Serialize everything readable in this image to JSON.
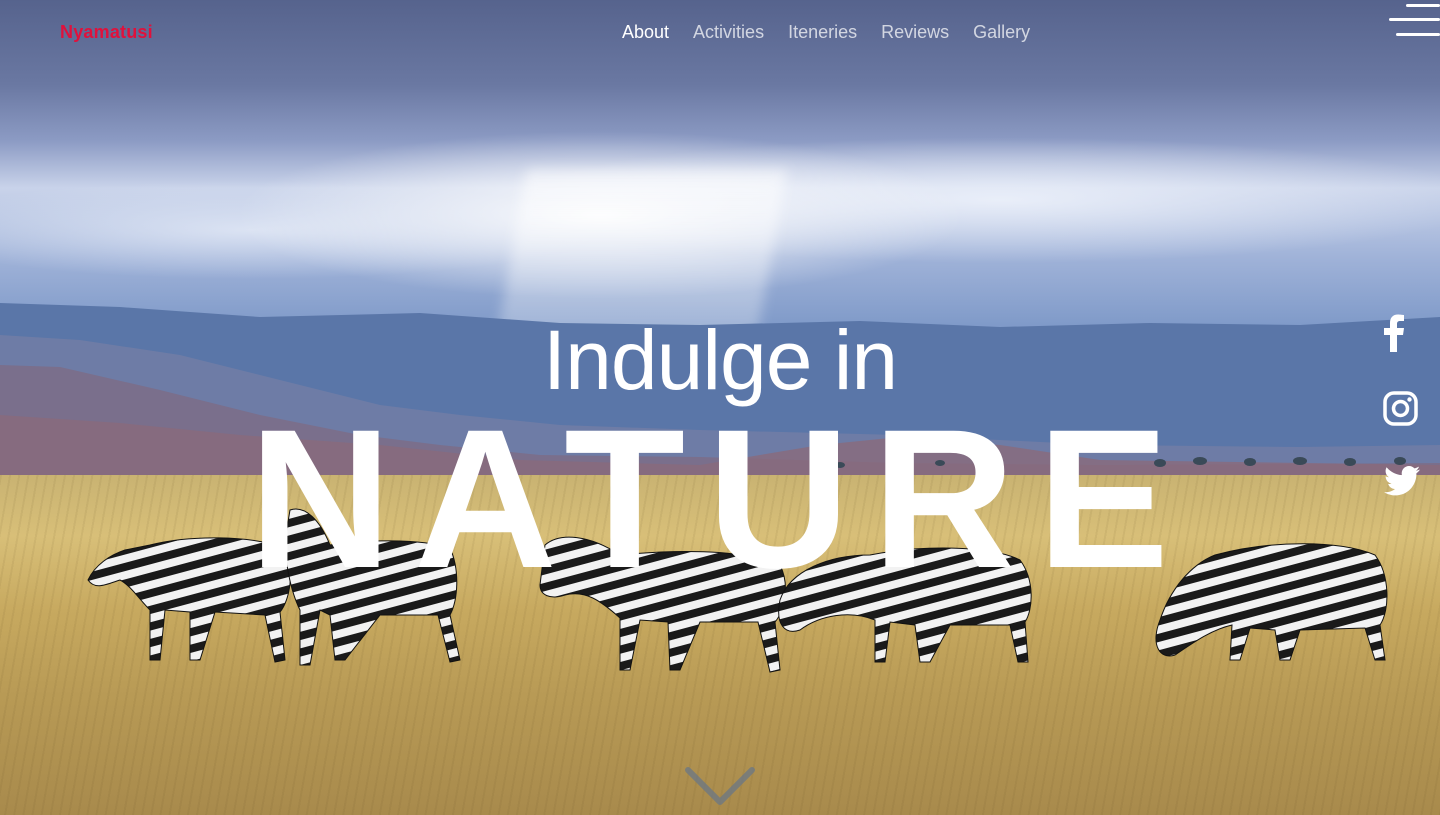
{
  "header": {
    "brand": "Nyamatusi",
    "nav": [
      {
        "label": "About",
        "active": true
      },
      {
        "label": "Activities",
        "active": false
      },
      {
        "label": "Iteneries",
        "active": false
      },
      {
        "label": "Reviews",
        "active": false
      },
      {
        "label": "Gallery",
        "active": false
      }
    ],
    "menu_icon": "hamburger-menu-icon"
  },
  "hero": {
    "tagline": "Indulge in",
    "headline": "NATURE",
    "scroll_icon": "chevron-down-icon"
  },
  "social": [
    {
      "name": "facebook-icon"
    },
    {
      "name": "instagram-icon"
    },
    {
      "name": "twitter-icon"
    }
  ],
  "colors": {
    "brand": "#e0113c",
    "nav_active": "#ffffff",
    "nav_inactive": "rgba(255,255,255,0.72)"
  }
}
